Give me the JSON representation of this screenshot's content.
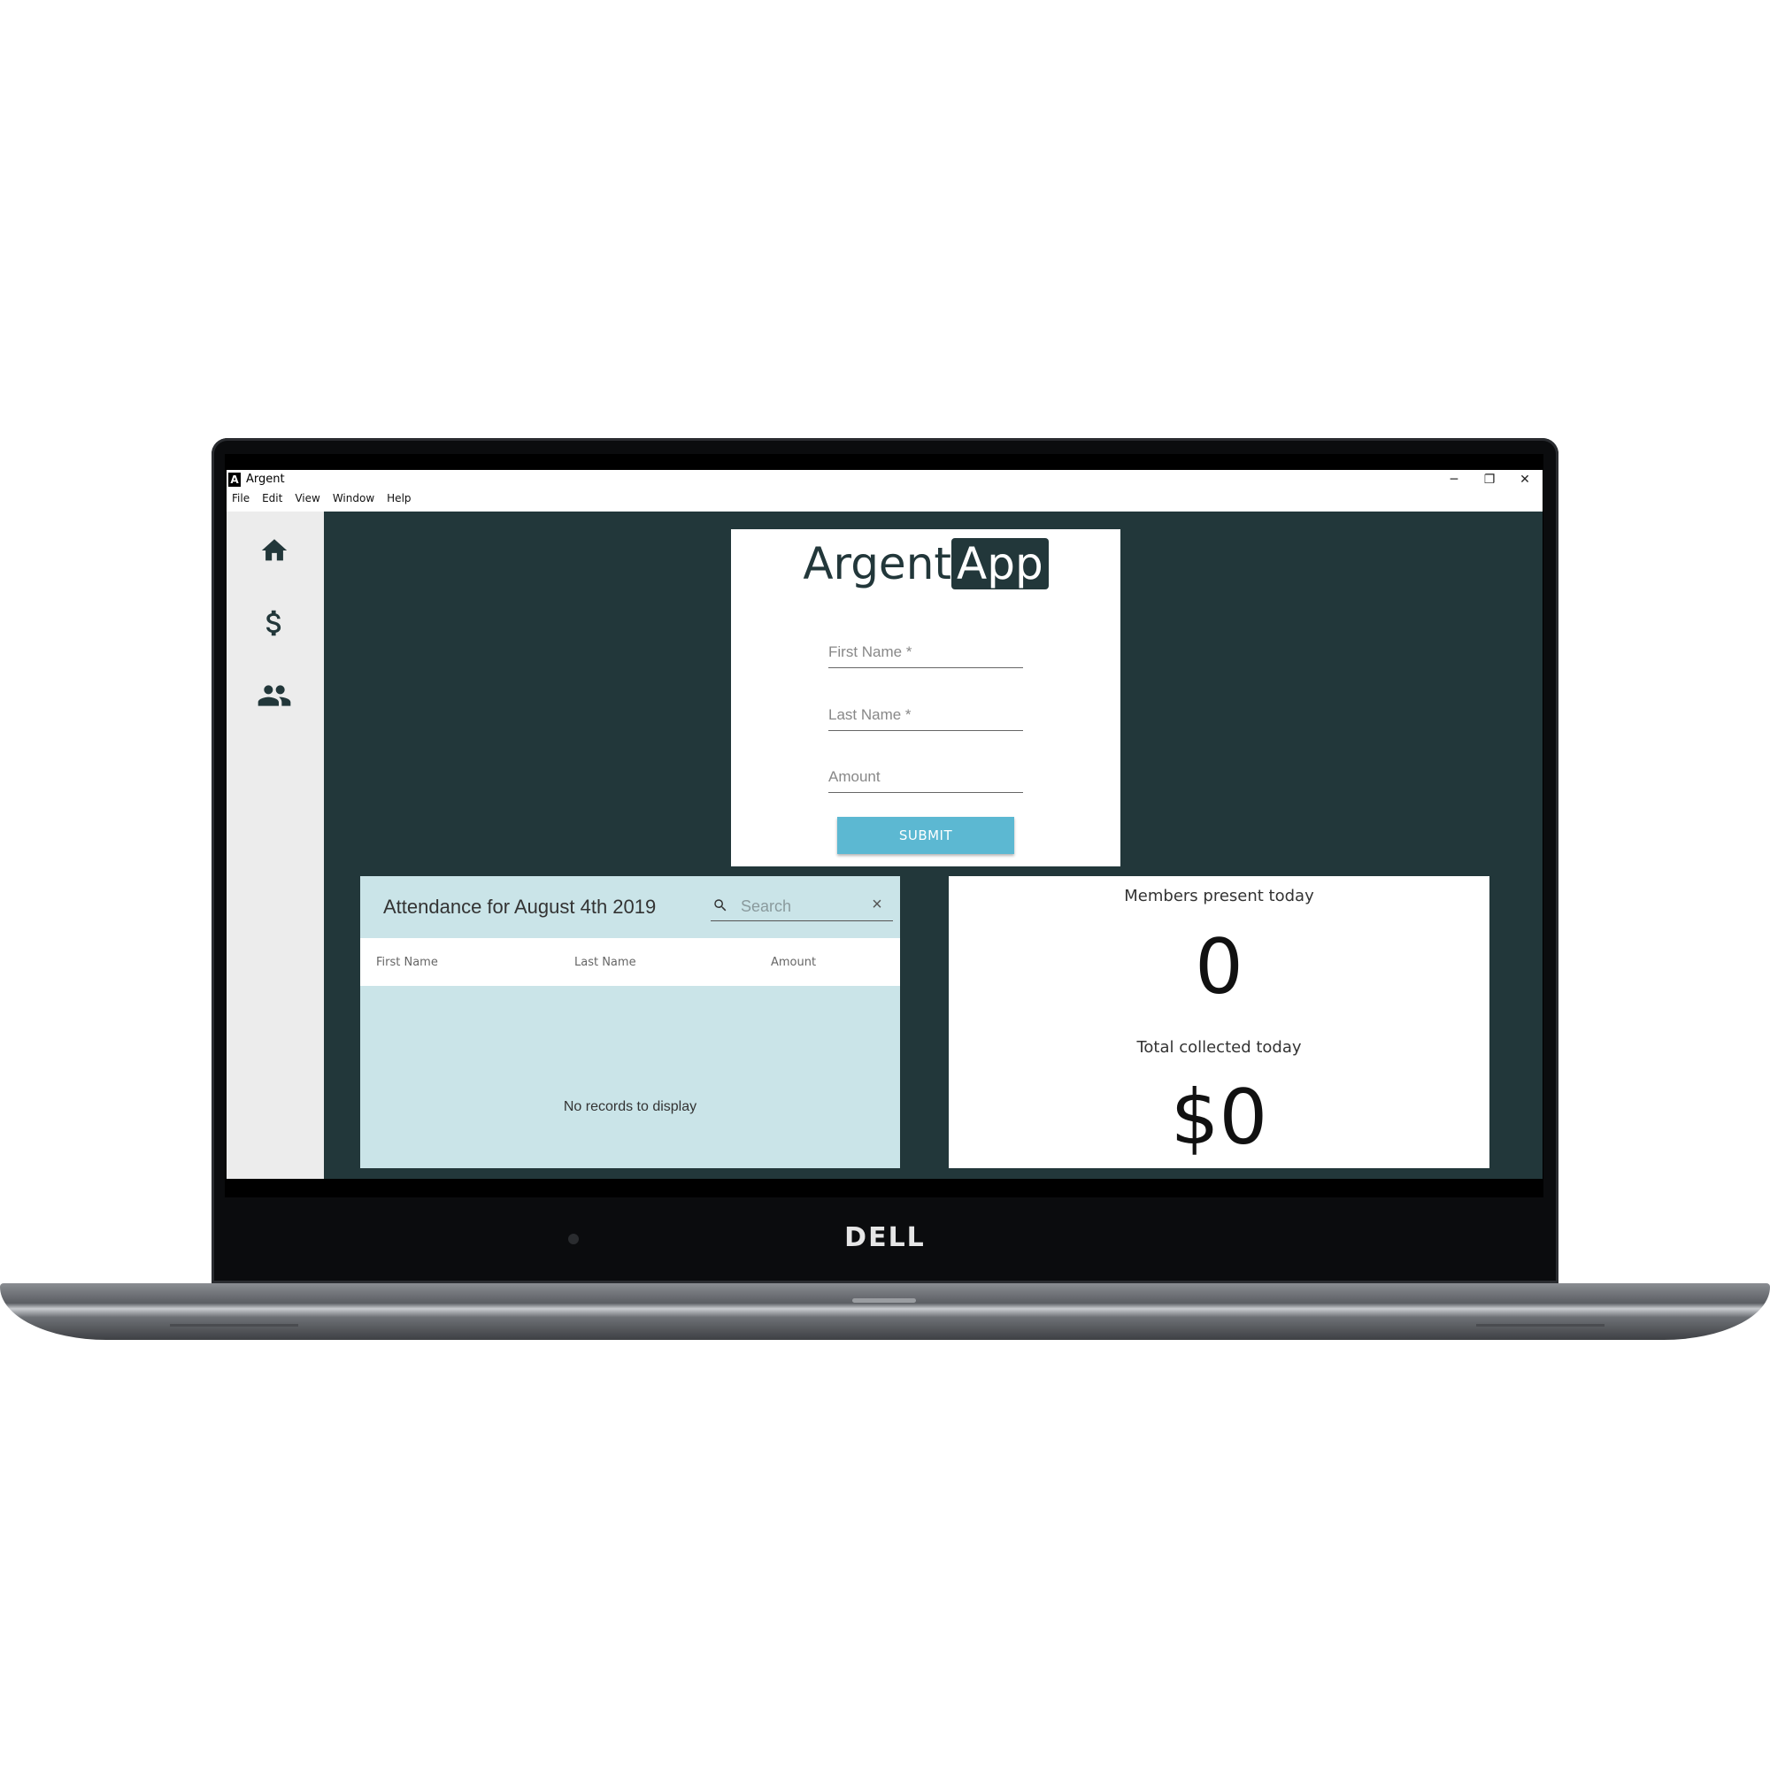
{
  "window": {
    "app_icon_letter": "A",
    "title": "Argent",
    "controls": {
      "minimize": "─",
      "restore": "❐",
      "close": "✕"
    }
  },
  "menubar": [
    "File",
    "Edit",
    "View",
    "Window",
    "Help"
  ],
  "sidebar": {
    "items": [
      {
        "icon": "home-icon"
      },
      {
        "icon": "dollar-icon"
      },
      {
        "icon": "people-icon"
      }
    ]
  },
  "form": {
    "brand_plain": "Argent",
    "brand_highlight": "App",
    "first_name_placeholder": "First Name *",
    "last_name_placeholder": "Last Name *",
    "amount_placeholder": "Amount",
    "submit_label": "SUBMIT"
  },
  "attendance": {
    "title": "Attendance for August 4th 2019",
    "search_placeholder": "Search",
    "columns": [
      "First Name",
      "Last Name",
      "Amount"
    ],
    "empty_message": "No records to display"
  },
  "stats": {
    "members_label": "Members present today",
    "members_value": "0",
    "total_label": "Total collected today",
    "total_value": "$0"
  },
  "hardware": {
    "brand": "DELL"
  },
  "colors": {
    "main_bg": "#22373a",
    "sidebar_bg": "#ececec",
    "table_bg": "#cae4e8",
    "submit_bg": "#5cb8d2"
  }
}
